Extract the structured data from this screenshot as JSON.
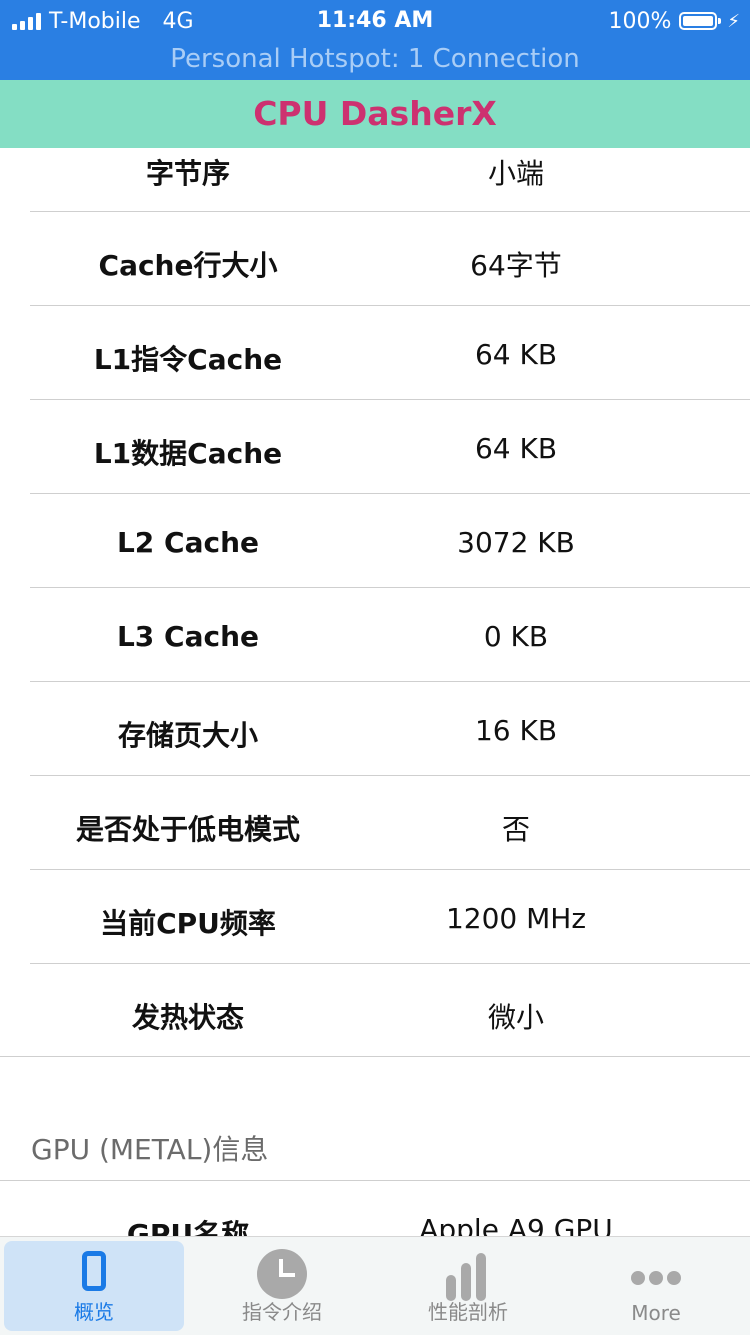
{
  "status_bar": {
    "carrier": "T-Mobile",
    "network": "4G",
    "time": "11:46 AM",
    "battery": "100%",
    "hotspot": "Personal Hotspot: 1 Connection"
  },
  "app": {
    "title": "CPU DasherX"
  },
  "cpu_info": [
    {
      "label": "字节序",
      "value": "小端"
    },
    {
      "label": "Cache行大小",
      "value": "64字节"
    },
    {
      "label": "L1指令Cache",
      "value": "64 KB"
    },
    {
      "label": "L1数据Cache",
      "value": "64 KB"
    },
    {
      "label": "L2 Cache",
      "value": "3072 KB"
    },
    {
      "label": "L3 Cache",
      "value": "0 KB"
    },
    {
      "label": "存储页大小",
      "value": "16 KB"
    },
    {
      "label": "是否处于低电模式",
      "value": "否"
    },
    {
      "label": "当前CPU频率",
      "value": "1200 MHz"
    },
    {
      "label": "发热状态",
      "value": "微小"
    }
  ],
  "gpu_section": {
    "header": "GPU (METAL)信息",
    "rows": [
      {
        "label": "GPU名称",
        "value": "Apple A9 GPU"
      }
    ]
  },
  "tabbar": {
    "tabs": [
      {
        "label": "概览",
        "icon": "phone-icon",
        "active": true
      },
      {
        "label": "指令介绍",
        "icon": "clock-icon",
        "active": false
      },
      {
        "label": "性能剖析",
        "icon": "bar-chart-icon",
        "active": false
      },
      {
        "label": "More",
        "icon": "more-dots-icon",
        "active": false
      }
    ]
  },
  "colors": {
    "status_bar_bg": "#2a7fe3",
    "title_bar_bg": "#84dec4",
    "title_text": "#cd3170",
    "tab_active": "#1a7ae6"
  }
}
